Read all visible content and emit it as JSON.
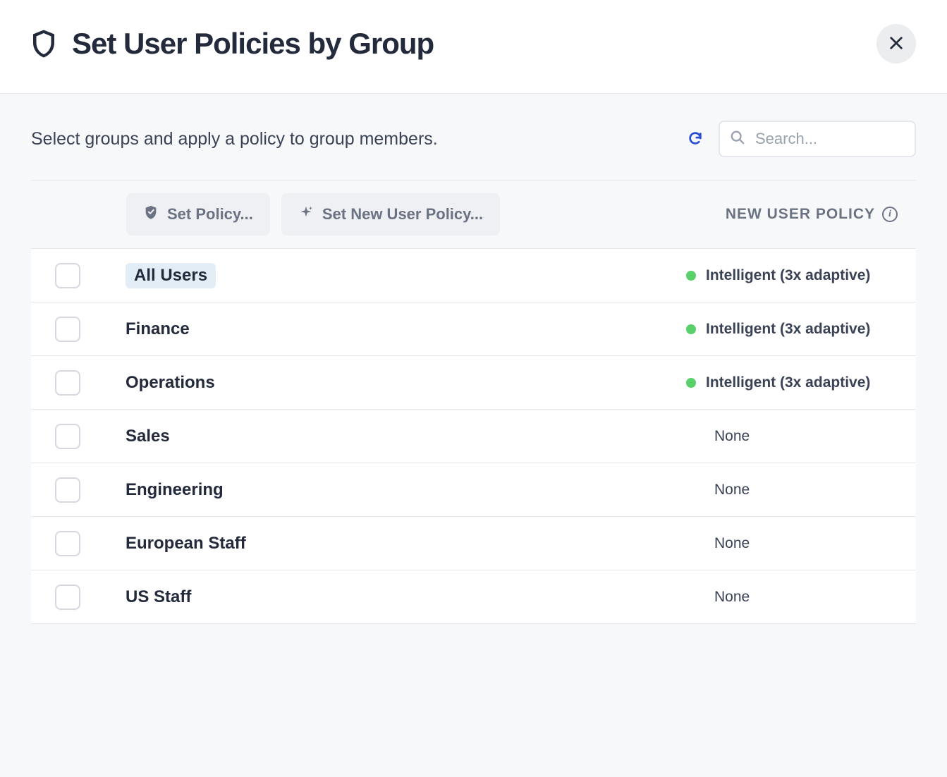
{
  "header": {
    "title": "Set User Policies by Group"
  },
  "subtitle": "Select groups and apply a policy to group members.",
  "search": {
    "placeholder": "Search..."
  },
  "toolbar": {
    "set_policy_label": "Set Policy...",
    "set_new_user_policy_label": "Set New User Policy...",
    "column_header": "NEW USER POLICY"
  },
  "groups": [
    {
      "name": "All Users",
      "highlighted": true,
      "policy": "Intelligent (3x adaptive)",
      "has_policy": true
    },
    {
      "name": "Finance",
      "highlighted": false,
      "policy": "Intelligent (3x adaptive)",
      "has_policy": true
    },
    {
      "name": "Operations",
      "highlighted": false,
      "policy": "Intelligent (3x adaptive)",
      "has_policy": true
    },
    {
      "name": "Sales",
      "highlighted": false,
      "policy": "None",
      "has_policy": false
    },
    {
      "name": "Engineering",
      "highlighted": false,
      "policy": "None",
      "has_policy": false
    },
    {
      "name": "European Staff",
      "highlighted": false,
      "policy": "None",
      "has_policy": false
    },
    {
      "name": "US Staff",
      "highlighted": false,
      "policy": "None",
      "has_policy": false
    }
  ]
}
